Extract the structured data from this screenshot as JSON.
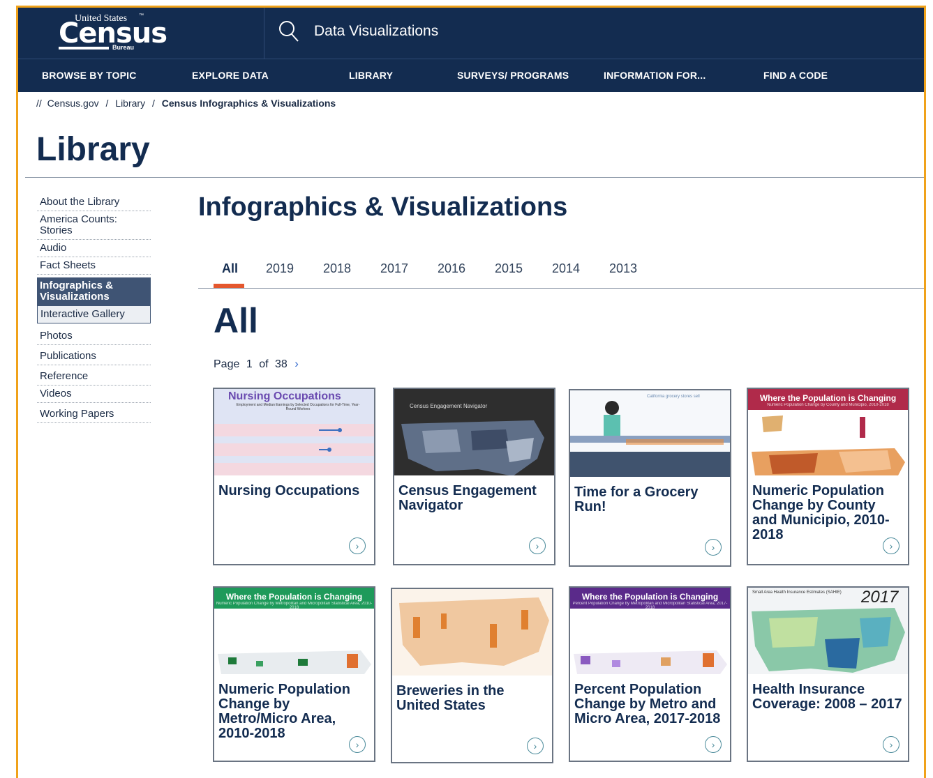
{
  "logo": {
    "line1": "United States",
    "tm": "™",
    "line2": "Census",
    "line3": "Bureau"
  },
  "search": {
    "text": "Data Visualizations"
  },
  "nav": [
    "BROWSE BY TOPIC",
    "EXPLORE DATA",
    "LIBRARY",
    "SURVEYS/ PROGRAMS",
    "INFORMATION FOR...",
    "FIND A CODE"
  ],
  "breadcrumb": {
    "prefix": "//",
    "home": "Census.gov",
    "sep": "/",
    "library": "Library",
    "current": "Census Infographics & Visualizations"
  },
  "page_title": "Library",
  "sidebar": {
    "items": [
      "About the Library",
      "America Counts: Stories",
      "Audio",
      "Fact Sheets",
      "Infographics & Visualizations",
      "Interactive Gallery",
      "Photos",
      "Publications",
      "Reference",
      "Videos",
      "Working Papers"
    ]
  },
  "section_title": "Infographics & Visualizations",
  "tabs": [
    "All",
    "2019",
    "2018",
    "2017",
    "2016",
    "2015",
    "2014",
    "2013"
  ],
  "all_heading": "All",
  "pager": {
    "page_label": "Page",
    "current": "1",
    "of_label": "of",
    "total": "38",
    "next": "›"
  },
  "cards": [
    {
      "title": "Nursing Occupations",
      "thumb_title": "Nursing Occupations",
      "thumb_sub": "Employment and Median Earnings by Selected Occupations for Full-Time, Year-Round Workers"
    },
    {
      "title": "Census Engagement Navigator",
      "thumb_title": "Census Engagement Navigator"
    },
    {
      "title": "Time for a Grocery Run!",
      "thumb_title": "California grocery stores sell"
    },
    {
      "title": "Numeric Population Change by County and Municipio, 2010-2018",
      "thumb_title": "Where the Population is Changing",
      "thumb_sub": "Numeric Population Change by County and Municipio, 2010-2018"
    },
    {
      "title": "Numeric Population Change by Metro/Micro Area, 2010-2018",
      "thumb_title": "Where the Population is Changing",
      "thumb_sub": "Numeric Population Change by Metropolitan and Micropolitan Statistical Area, 2010-2018"
    },
    {
      "title": "Breweries in the United States"
    },
    {
      "title": "Percent Population Change by Metro and Micro Area, 2017-2018",
      "thumb_title": "Where the Population is Changing",
      "thumb_sub": "Percent Population Change by Metropolitan and Micropolitan Statistical Area, 2017-2018"
    },
    {
      "title": "Health Insurance Coverage: 2008 – 2017",
      "thumb_title": "Small Area Health Insurance Estimates (SAHIE)",
      "thumb_year": "2017"
    }
  ],
  "card_arrow": "›",
  "colors": {
    "navy": "#132c50",
    "accent": "#e4572e",
    "frame": "#f0a21a"
  }
}
